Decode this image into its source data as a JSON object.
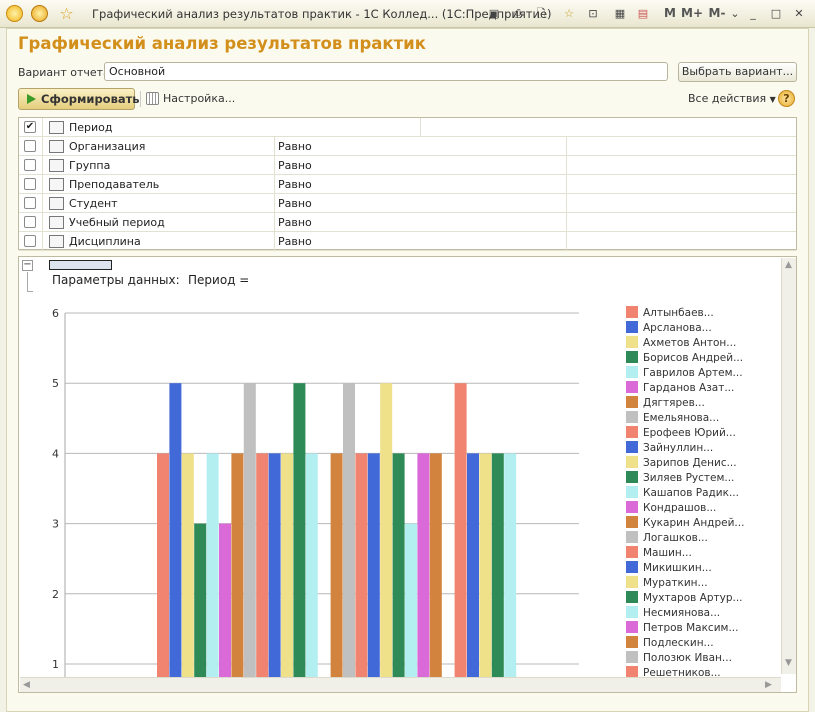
{
  "window": {
    "title": "Графический анализ результатов практик - 1С Коллед...  (1С:Предприятие)",
    "toolbar_m": "M",
    "toolbar_mplus": "M+",
    "toolbar_mminus": "M-"
  },
  "form": {
    "heading": "Графический анализ результатов практик",
    "variant_label": "Вариант отчета:",
    "variant_value": "Основной",
    "choose_variant_button": "Выбрать вариант...",
    "generate_button": "Сформировать",
    "settings_button": "Настройка...",
    "all_actions": "Все действия",
    "help": "?"
  },
  "parameters": [
    {
      "name": "Период",
      "condition": "",
      "checked": true
    },
    {
      "name": "Организация",
      "condition": "Равно",
      "checked": false
    },
    {
      "name": "Группа",
      "condition": "Равно",
      "checked": false
    },
    {
      "name": "Преподаватель",
      "condition": "Равно",
      "checked": false
    },
    {
      "name": "Студент",
      "condition": "Равно",
      "checked": false
    },
    {
      "name": "Учебный период",
      "condition": "Равно",
      "checked": false
    },
    {
      "name": "Дисциплина",
      "condition": "Равно",
      "checked": false
    }
  ],
  "report": {
    "data_params_label": "Параметры данных:",
    "period_label": "Период ="
  },
  "colors": {
    "accent_heading": "#d38f1b",
    "generate_button": "#e4cd7c",
    "palette": [
      "#f08470",
      "#4169d8",
      "#efe08a",
      "#2e8b57",
      "#b3eef0",
      "#d96ad8",
      "#d2843e",
      "#c0c0c0"
    ]
  },
  "chart_data": {
    "type": "bar",
    "ylim": [
      1,
      6
    ],
    "yticks": [
      "1",
      "2",
      "3",
      "4",
      "5",
      "6"
    ],
    "legend_position": "right",
    "legend": [
      "Алтынбаев...",
      "Арсланова...",
      "Ахметов Антон...",
      "Борисов Андрей...",
      "Гаврилов Артем...",
      "Гарданов Азат...",
      "Дягтярев...",
      "Емельянова...",
      "Ерофеев Юрий...",
      "Зайнуллин...",
      "Зарипов Денис...",
      "Зиляев Рустем...",
      "Кашапов Радик...",
      "Кондрашов...",
      "Кукарин Андрей...",
      "Логашков...",
      "Машин...",
      "Микишкин...",
      "Мураткин...",
      "Мухтаров Артур...",
      "Несмиянова...",
      "Петров Максим...",
      "Подлескин...",
      "Полозюк Иван...",
      "Решетников..."
    ],
    "bars": [
      {
        "series": 0,
        "value": 4
      },
      {
        "series": 1,
        "value": 5
      },
      {
        "series": 2,
        "value": 4
      },
      {
        "series": 3,
        "value": 3
      },
      {
        "series": 4,
        "value": 4
      },
      {
        "series": 5,
        "value": 3
      },
      {
        "series": 6,
        "value": 4
      },
      {
        "series": 7,
        "value": 5
      },
      {
        "series": 8,
        "value": 4
      },
      {
        "series": 9,
        "value": 4
      },
      {
        "series": 10,
        "value": 4
      },
      {
        "series": 11,
        "value": 5
      },
      {
        "series": 12,
        "value": 4
      },
      {
        "series": 14,
        "value": 4
      },
      {
        "series": 15,
        "value": 5
      },
      {
        "series": 16,
        "value": 4
      },
      {
        "series": 17,
        "value": 4
      },
      {
        "series": 18,
        "value": 5
      },
      {
        "series": 19,
        "value": 4
      },
      {
        "series": 20,
        "value": 3
      },
      {
        "series": 21,
        "value": 4
      },
      {
        "series": 22,
        "value": 4
      },
      {
        "series": 24,
        "value": 5
      },
      {
        "series": 25,
        "value": 4
      },
      {
        "series": 26,
        "value": 4
      },
      {
        "series": 27,
        "value": 4
      },
      {
        "series": 28,
        "value": 4
      }
    ]
  }
}
